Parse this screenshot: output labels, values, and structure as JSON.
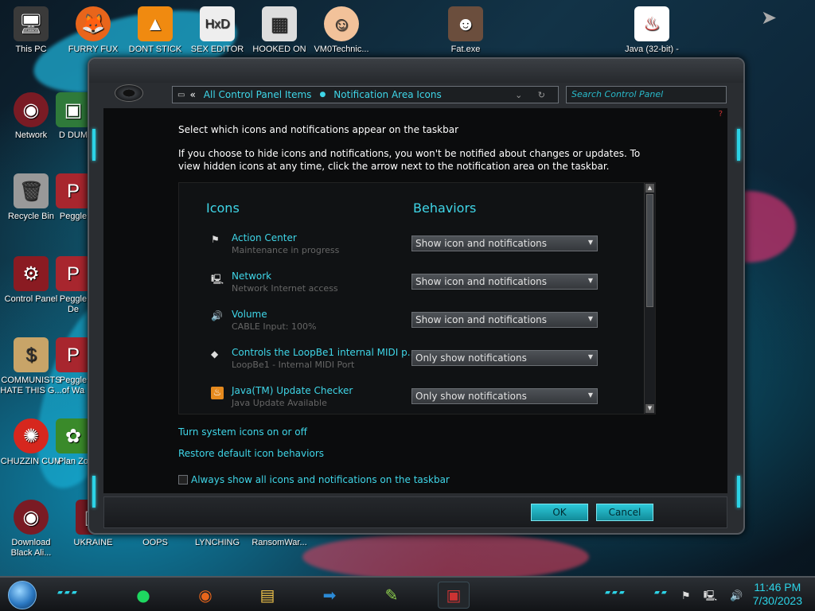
{
  "desktop": {
    "icons_top": [
      "This PC",
      "FURRY FUX",
      "DONT STICK",
      "SEX EDITOR",
      "HOOKED ON",
      "VM0Technic...",
      "Fat.exe",
      "Java (32-bit) -"
    ],
    "icons_left": [
      "Network",
      "Recycle Bin",
      "Control Panel",
      "COMMUNISTS HATE THIS G...",
      "CHUZZIN CUM",
      "Download Black Ali..."
    ],
    "icons_col2": [
      "D DUM",
      "Peggle",
      "Peggle De",
      "Peggle of Wa",
      "Plan Zo",
      "UKRAINE"
    ],
    "icons_bottom": [
      "OOPS",
      "LYNCHING",
      "RansomWar..."
    ]
  },
  "window": {
    "address": {
      "back": "«",
      "crumb1": "All Control Panel Items",
      "separator": "●",
      "crumb2": "Notification Area Icons",
      "controls": "⌄ ↻"
    },
    "search_placeholder": "Search Control Panel",
    "help": "?",
    "heading": "Select which icons and notifications appear on the taskbar",
    "description": "If you choose to hide icons and notifications, you won't be notified about changes or updates. To view hidden icons at any time, click the arrow next to the notification area on the taskbar.",
    "col_icons": "Icons",
    "col_behaviors": "Behaviors",
    "rows": [
      {
        "name": "Action Center",
        "sub": "Maintenance in progress",
        "behavior": "Show icon and notifications",
        "icon": "flag-icon",
        "glyph": "⚑"
      },
      {
        "name": "Network",
        "sub": "Network Internet access",
        "behavior": "Show icon and notifications",
        "icon": "network-icon",
        "glyph": "🖳"
      },
      {
        "name": "Volume",
        "sub": "CABLE Input: 100%",
        "behavior": "Show icon and notifications",
        "icon": "speaker-icon",
        "glyph": "🔊"
      },
      {
        "name": "Controls the LoopBe1 internal MIDI p...",
        "sub": "LoopBe1 - Internal MIDI Port",
        "behavior": "Only show notifications",
        "icon": "midi-icon",
        "glyph": "◆"
      },
      {
        "name": "Java(TM) Update Checker",
        "sub": "Java Update Available",
        "behavior": "Only show notifications",
        "icon": "java-icon",
        "glyph": "♨"
      }
    ],
    "link_system_icons": "Turn system icons on or off",
    "link_restore": "Restore default icon behaviors",
    "checkbox_label": "Always show all icons and notifications on the taskbar",
    "ok": "OK",
    "cancel": "Cancel"
  },
  "taskbar": {
    "time": "11:46 PM",
    "date": "7/30/2023",
    "tray_icons": "⚑ 🖳 🔊"
  },
  "colors": {
    "accent": "#3fd6e8",
    "window_bg": "#2a2d31",
    "content_bg": "#0b0c0d"
  }
}
